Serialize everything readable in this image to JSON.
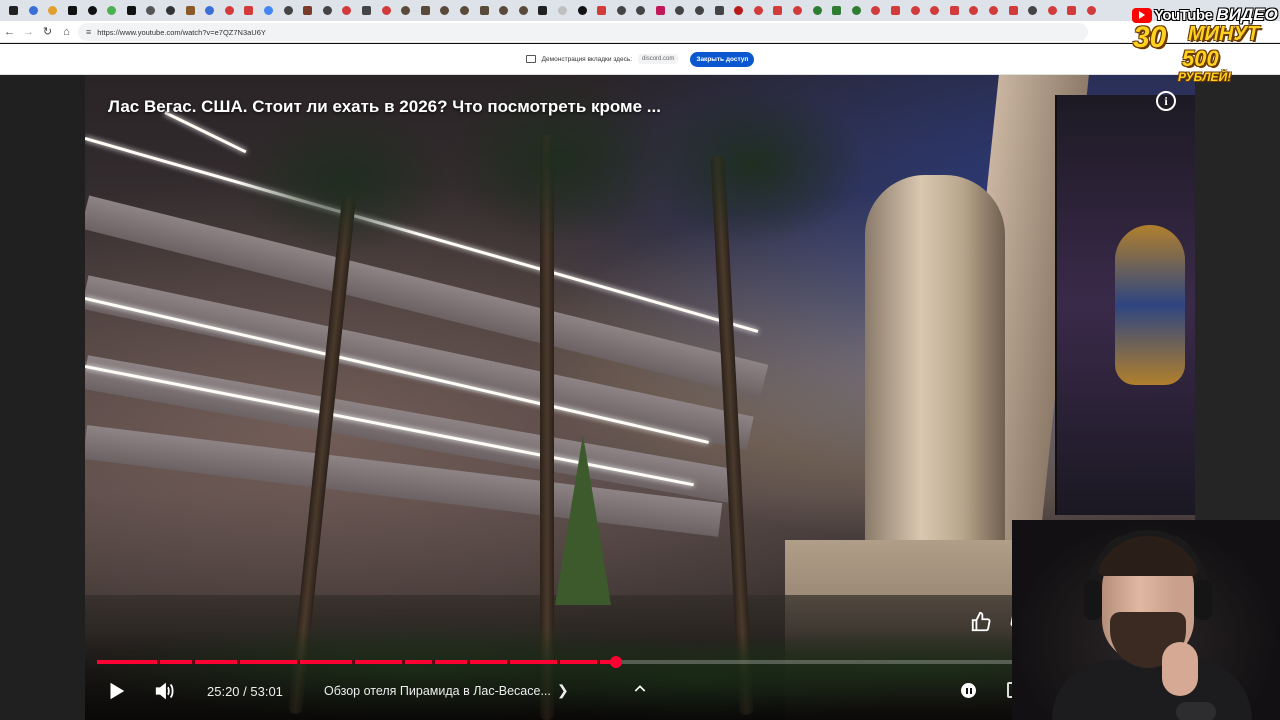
{
  "browser": {
    "url": "https://www.youtube.com/watch?v=e7QZ7N3aU6Y",
    "tab_favicons": [
      {
        "icon": "youtube-icon",
        "color": "#222222"
      },
      {
        "icon": "app-icon",
        "color": "#3b6fd6"
      },
      {
        "icon": "app-icon",
        "color": "#e0a030"
      },
      {
        "icon": "x-icon",
        "color": "#111111"
      },
      {
        "icon": "x-icon",
        "color": "#111111"
      },
      {
        "icon": "app-icon",
        "color": "#4caf50"
      },
      {
        "icon": "x-icon",
        "color": "#111111"
      },
      {
        "icon": "gmail-icon",
        "color": "#555555"
      },
      {
        "icon": "app-icon",
        "color": "#333333"
      },
      {
        "icon": "app-icon",
        "color": "#8b5a2b"
      },
      {
        "icon": "docs-icon",
        "color": "#3b6fd6"
      },
      {
        "icon": "app-icon",
        "color": "#d23b3b"
      },
      {
        "icon": "app-icon",
        "color": "#d23b3b"
      },
      {
        "icon": "google-icon",
        "color": "#4285f4"
      },
      {
        "icon": "app-icon",
        "color": "#444444"
      },
      {
        "icon": "app-icon",
        "color": "#7a3b2b"
      },
      {
        "icon": "app-icon",
        "color": "#444444"
      },
      {
        "icon": "app-icon",
        "color": "#d23b3b"
      },
      {
        "icon": "app-icon",
        "color": "#444444"
      },
      {
        "icon": "app-icon",
        "color": "#d23b3b"
      },
      {
        "icon": "app-icon",
        "color": "#5a4a3a"
      },
      {
        "icon": "app-icon",
        "color": "#5a4a3a"
      },
      {
        "icon": "app-icon",
        "color": "#5a4a3a"
      },
      {
        "icon": "app-icon",
        "color": "#5a4a3a"
      },
      {
        "icon": "app-icon",
        "color": "#5a4a3a"
      },
      {
        "icon": "app-icon",
        "color": "#5a4a3a"
      },
      {
        "icon": "app-icon",
        "color": "#5a4a3a"
      },
      {
        "icon": "app-icon",
        "color": "#222222"
      },
      {
        "icon": "app-icon",
        "color": "#c0c0c0"
      },
      {
        "icon": "app-icon",
        "color": "#111111"
      },
      {
        "icon": "app-icon",
        "color": "#d23b3b"
      },
      {
        "icon": "app-icon",
        "color": "#444444"
      },
      {
        "icon": "app-icon",
        "color": "#444444"
      },
      {
        "icon": "app-icon",
        "color": "#c2185b"
      },
      {
        "icon": "app-icon",
        "color": "#444444"
      },
      {
        "icon": "app-icon",
        "color": "#444444"
      },
      {
        "icon": "app-icon",
        "color": "#444444"
      },
      {
        "icon": "app-icon",
        "color": "#b71c1c"
      },
      {
        "icon": "app-icon",
        "color": "#d23b3b"
      },
      {
        "icon": "app-icon",
        "color": "#d23b3b"
      },
      {
        "icon": "app-icon",
        "color": "#d23b3b"
      },
      {
        "icon": "app-icon",
        "color": "#2e7d32"
      },
      {
        "icon": "app-icon",
        "color": "#2e7d32"
      },
      {
        "icon": "app-icon",
        "color": "#2e7d32"
      },
      {
        "icon": "app-icon",
        "color": "#d23b3b"
      },
      {
        "icon": "app-icon",
        "color": "#d23b3b"
      },
      {
        "icon": "app-icon",
        "color": "#d23b3b"
      },
      {
        "icon": "app-icon",
        "color": "#d23b3b"
      },
      {
        "icon": "app-icon",
        "color": "#d23b3b"
      },
      {
        "icon": "app-icon",
        "color": "#d23b3b"
      },
      {
        "icon": "app-icon",
        "color": "#d23b3b"
      },
      {
        "icon": "app-icon",
        "color": "#d23b3b"
      },
      {
        "icon": "app-icon",
        "color": "#444444"
      },
      {
        "icon": "app-icon",
        "color": "#d23b3b"
      },
      {
        "icon": "app-icon",
        "color": "#d23b3b"
      },
      {
        "icon": "app-icon",
        "color": "#d23b3b"
      }
    ]
  },
  "sharing_bar": {
    "text": "Демонстрация вкладки здесь:",
    "domain": "discord.com",
    "stop_button": "Закрыть доступ"
  },
  "video": {
    "title": "Лас Вегас. США. Стоит ли ехать в 2026? Что посмотреть кроме ...",
    "current_time": "25:20",
    "duration": "53:01",
    "time_display": "25:20 / 53:01",
    "chapter": "Обзор отеля Пирамида в Лас-Весасе...",
    "progress_fraction": 0.4776,
    "accent_color": "#ff0033"
  },
  "promo": {
    "brand": "YouTube",
    "label": "ВИДЕО",
    "number": "30",
    "minutes": "МИНУТ",
    "price": "500",
    "currency": "РУБЛЕЙ!"
  }
}
